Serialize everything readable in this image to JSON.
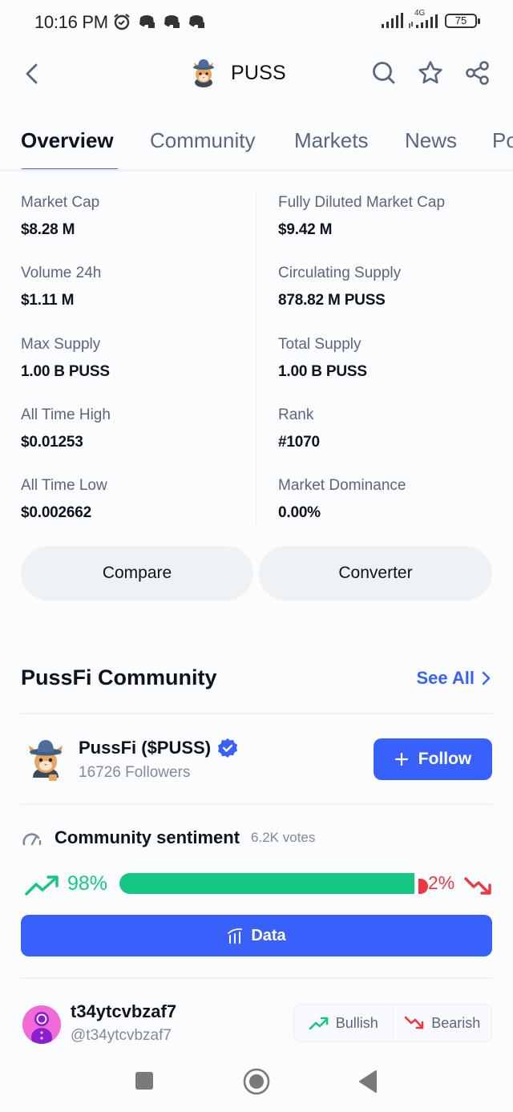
{
  "status_bar": {
    "time": "10:16 PM",
    "network": "4G",
    "battery": "75"
  },
  "header": {
    "title": "PUSS",
    "icons": [
      "back-icon",
      "search-icon",
      "star-icon",
      "share-icon"
    ]
  },
  "tabs": [
    {
      "label": "Overview",
      "active": true
    },
    {
      "label": "Community",
      "active": false
    },
    {
      "label": "Markets",
      "active": false
    },
    {
      "label": "News",
      "active": false
    },
    {
      "label": "Po",
      "active": false
    }
  ],
  "stats": {
    "left": [
      {
        "label": "Market Cap",
        "value": "$8.28 M"
      },
      {
        "label": "Volume 24h",
        "value": "$1.11 M"
      },
      {
        "label": "Max Supply",
        "value": "1.00 B PUSS"
      },
      {
        "label": "All Time High",
        "value": "$0.01253"
      },
      {
        "label": "All Time Low",
        "value": "$0.002662"
      }
    ],
    "right": [
      {
        "label": "Fully Diluted Market Cap",
        "value": "$9.42 M"
      },
      {
        "label": "Circulating Supply",
        "value": "878.82 M PUSS"
      },
      {
        "label": "Total Supply",
        "value": "1.00 B PUSS"
      },
      {
        "label": "Rank",
        "value": "#1070"
      },
      {
        "label": "Market Dominance",
        "value": "0.00%"
      }
    ]
  },
  "actions": {
    "compare": "Compare",
    "converter": "Converter"
  },
  "community": {
    "title": "PussFi Community",
    "see_all": "See All",
    "name": "PussFi ($PUSS)",
    "verified": true,
    "followers": "16726 Followers",
    "follow_label": "Follow"
  },
  "sentiment": {
    "title": "Community sentiment",
    "votes": "6.2K votes",
    "bullish_pct": 98,
    "bearish_pct": 2,
    "bullish_label": "98%",
    "bearish_label": "2%",
    "bullish_color": "#16c784",
    "bearish_color": "#ea3943",
    "data_button": "Data"
  },
  "post": {
    "name": "t34ytcvbzaf7",
    "handle": "@t34ytcvbzaf7",
    "bullish": "Bullish",
    "bearish": "Bearish"
  },
  "colors": {
    "accent": "#3861fb",
    "text_primary": "#0d1421",
    "text_secondary": "#58667e"
  }
}
